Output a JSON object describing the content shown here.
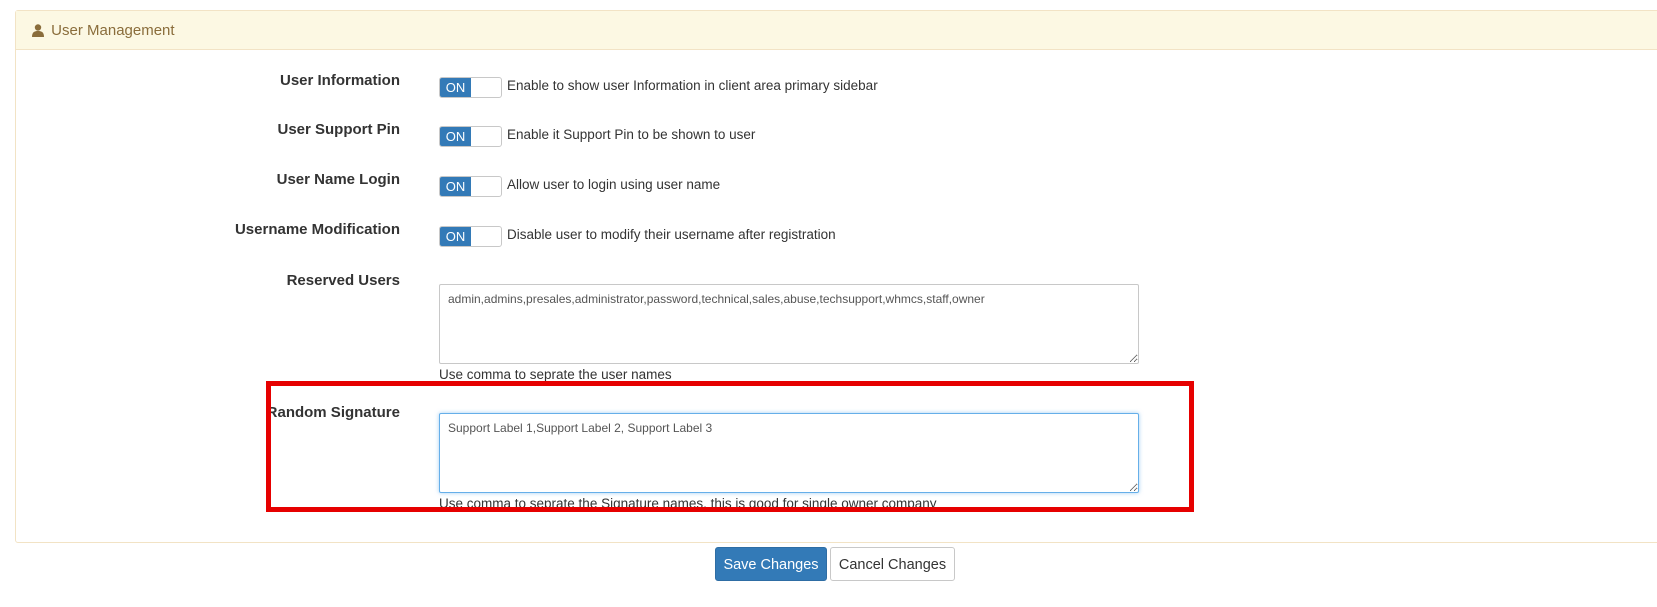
{
  "panel": {
    "title": "User Management",
    "icon": "user-icon",
    "heading_bg": "#fcf8e3",
    "heading_color": "#8a6d3b"
  },
  "settings": [
    {
      "label": "User Information",
      "toggle": "ON",
      "description": "Enable to show user Information in client area primary sidebar"
    },
    {
      "label": "User Support Pin",
      "toggle": "ON",
      "description": "Enable it Support Pin to be shown to user"
    },
    {
      "label": "User Name Login",
      "toggle": "ON",
      "description": "Allow user to login using user name"
    },
    {
      "label": "Username Modification",
      "toggle": "ON",
      "description": "Disable user to modify their username after registration"
    }
  ],
  "reserved_users": {
    "label": "Reserved Users",
    "value": "admin,admins,presales,administrator,password,technical,sales,abuse,techsupport,whmcs,staff,owner",
    "help": "Use comma to seprate the user names"
  },
  "random_signature": {
    "label": "Random Signature",
    "value": "Support Label 1,Support Label 2, Support Label 3",
    "help": "Use comma to seprate the Signature names, this is good for single owner company",
    "highlight_color": "#e60000"
  },
  "actions": {
    "save_label": "Save Changes",
    "cancel_label": "Cancel Changes",
    "primary_color": "#337ab7"
  }
}
